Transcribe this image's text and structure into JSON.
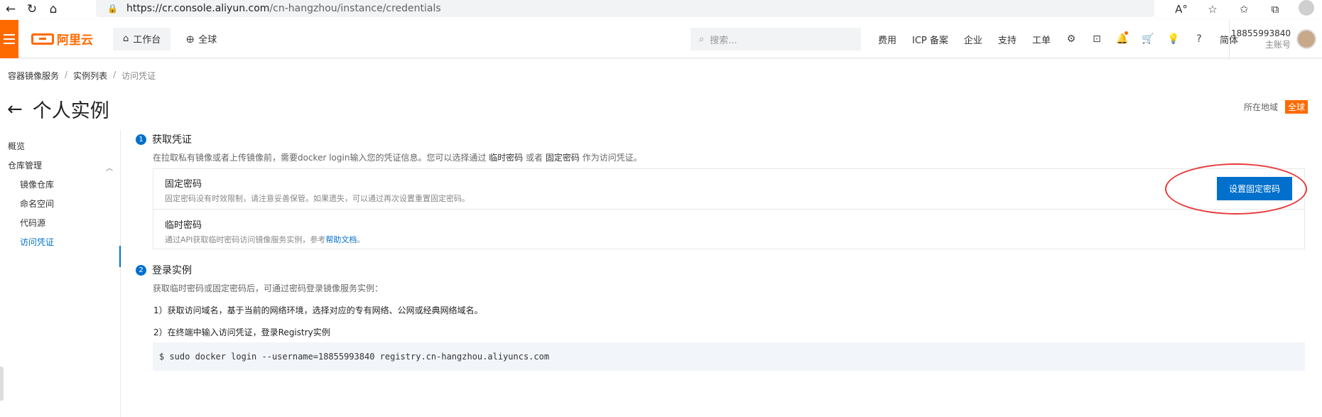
{
  "browser": {
    "url_host": "https://cr.console.aliyun.com",
    "url_path": "/cn-hangzhou/instance/credentials"
  },
  "topbar": {
    "logo_text": "阿里云",
    "workbench_label": "工作台",
    "global_label": "全球",
    "search_placeholder": "搜索...",
    "links": [
      "费用",
      "ICP 备案",
      "企业",
      "支持",
      "工单"
    ],
    "lang_label": "简体",
    "account_id": "18855993840",
    "account_role": "主账号"
  },
  "breadcrumb": [
    "容器镜像服务",
    "实例列表",
    "访问凭证"
  ],
  "page": {
    "title": "个人实例",
    "region_label": "所在地域",
    "region_value": "全球"
  },
  "sidebar": {
    "items": [
      "概览",
      "仓库管理",
      "镜像仓库",
      "命名空间",
      "代码源",
      "访问凭证"
    ],
    "active": "访问凭证"
  },
  "step1": {
    "num": "1",
    "title": "获取凭证",
    "desc_pre": "在拉取私有镜像或者上传镜像前，需要docker login输入您的凭证信息。您可以选择通过 ",
    "desc_temp": "临时密码",
    "desc_or": " 或者 ",
    "desc_fixed": "固定密码",
    "desc_post": " 作为访问凭证。"
  },
  "credentials": {
    "fixed_name": "固定密码",
    "fixed_desc": "固定密码没有时效限制，请注意妥善保管。如果遗失，可以通过再次设置重置固定密码。",
    "temp_name": "临时密码",
    "temp_desc_pre": "通过API获取临时密码访问镜像服务实例，参考",
    "temp_desc_link": "帮助文档",
    "temp_desc_post": "。",
    "set_button": "设置固定密码"
  },
  "step2": {
    "num": "2",
    "title": "登录实例",
    "desc": "获取临时密码或固定密码后，可通过密码登录镜像服务实例：",
    "instruction1": "1）获取访问域名，基于当前的网络环境，选择对应的专有网络、公网或经典网络域名。",
    "instruction2": "2）在终端中输入访问凭证，登录Registry实例",
    "command": "$ sudo docker login --username=18855993840 registry.cn-hangzhou.aliyuncs.com"
  },
  "colors": {
    "brand": "#ff6a00",
    "primary": "#0070cc",
    "annotation": "#e83a3a"
  }
}
